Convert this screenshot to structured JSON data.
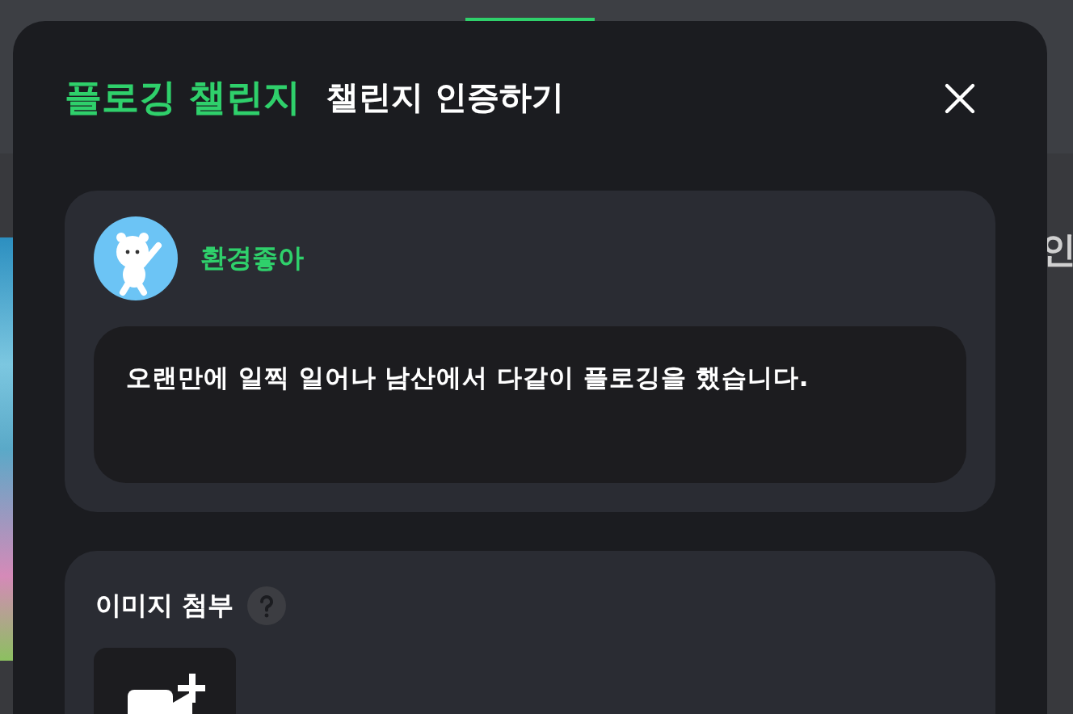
{
  "background": {
    "heading": "인"
  },
  "modal": {
    "title": "플로깅 챌린지",
    "subtitle": "챌린지 인증하기",
    "post": {
      "author": "환경좋아",
      "text": "오랜만에 일찍 일어나 남산에서 다같이 플로깅을 했습니다."
    },
    "attachment": {
      "label": "이미지 첨부"
    }
  }
}
